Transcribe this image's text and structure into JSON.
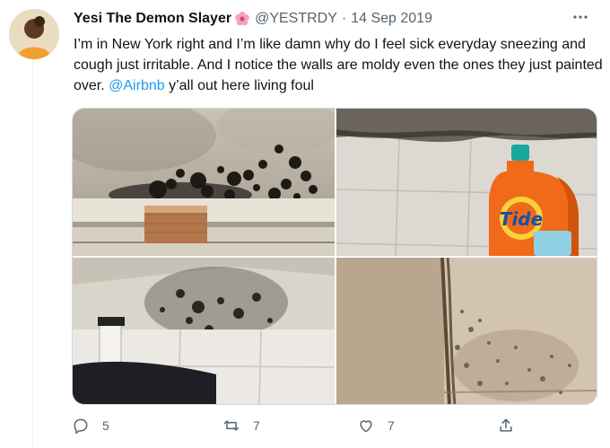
{
  "tweet": {
    "author_name": "Yesi The Demon Slayer",
    "handle": "@YESTRDY",
    "separator": "·",
    "date": "14 Sep 2019",
    "more_icon": "more-horizontal-icon",
    "text_before": "I’m in New York right and I’m like damn why do I feel sick everyday sneezing and cough just irritable. And I notice the walls are moldy even the ones they just painted over. ",
    "mention": "@Airbnb",
    "text_after": " y’all out here living foul"
  },
  "media": {
    "images": [
      {
        "name": "moldy-ceiling-photo"
      },
      {
        "name": "detergent-bottle-photo",
        "label": "Tide"
      },
      {
        "name": "moldy-wall-corner-photo"
      },
      {
        "name": "moldy-wall-seam-photo"
      }
    ]
  },
  "actions": {
    "reply_count": "5",
    "retweet_count": "7",
    "like_count": "7"
  },
  "colors": {
    "accent": "#1d9bf0",
    "muted": "#536471",
    "text": "#0f1419"
  }
}
